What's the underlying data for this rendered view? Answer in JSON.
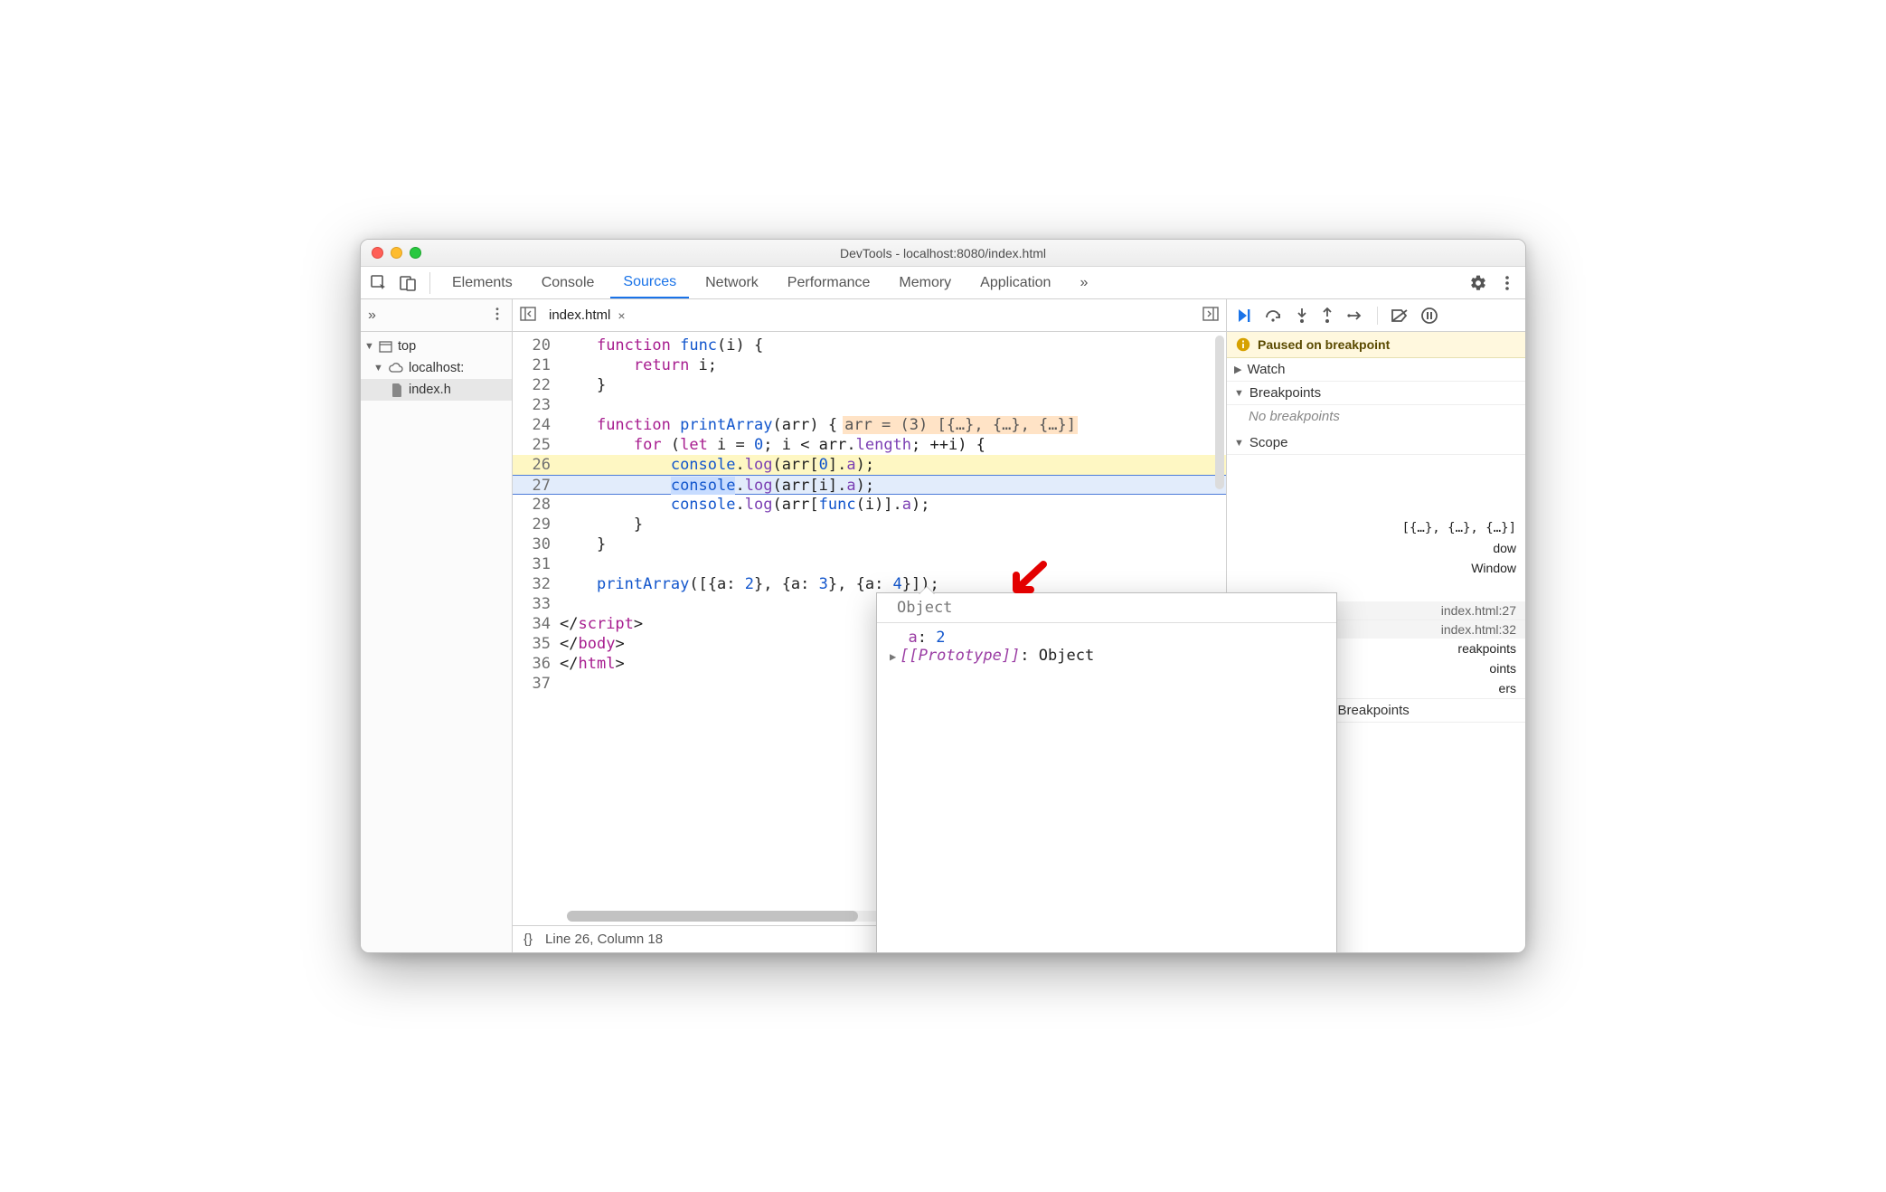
{
  "window": {
    "title": "DevTools - localhost:8080/index.html"
  },
  "tabs": {
    "items": [
      "Elements",
      "Console",
      "Sources",
      "Network",
      "Performance",
      "Memory",
      "Application"
    ],
    "activeIndex": 2,
    "overflow": "»"
  },
  "left": {
    "overflow": "»",
    "tree": {
      "root": "top",
      "host": "localhost:",
      "file": "index.h"
    }
  },
  "editor": {
    "tabName": "index.html",
    "closeGlyph": "×",
    "firstLine": 20,
    "highlightYellow": 26,
    "highlightBlue": 27,
    "lines": [
      {
        "raw": "    function func(i) {"
      },
      {
        "raw": "        return i;"
      },
      {
        "raw": "    }"
      },
      {
        "raw": ""
      },
      {
        "raw": "    function printArray(arr) {",
        "hint": "arr = (3) [{…}, {…}, {…}]"
      },
      {
        "raw": "        for (let i = 0; i < arr.length; ++i) {"
      },
      {
        "raw": "            console.log(arr[0].a);"
      },
      {
        "raw": "            console.log(arr[i].a);"
      },
      {
        "raw": "            console.log(arr[func(i)].a);"
      },
      {
        "raw": "        }"
      },
      {
        "raw": "    }"
      },
      {
        "raw": ""
      },
      {
        "raw": "    printArray([{a: 2}, {a: 3}, {a: 4}]);"
      },
      {
        "raw": ""
      },
      {
        "raw": "</script​>"
      },
      {
        "raw": "</body>"
      },
      {
        "raw": "</html>"
      },
      {
        "raw": ""
      }
    ],
    "status": {
      "braces": "{}",
      "pos": "Line 26, Column 18"
    }
  },
  "debug": {
    "pausedText": "Paused on breakpoint",
    "sections": {
      "watch": "Watch",
      "breakpoints": "Breakpoints",
      "breakpointsEmpty": "No breakpoints",
      "scope": "Scope",
      "callstackTail1": "[{…}, {…}, {…}]",
      "callstackTail2": "dow",
      "callstackTail3": "Window",
      "loc1": "index.html:27",
      "loc2": "index.html:32",
      "frag1": "reakpoints",
      "frag2": "oints",
      "frag3": "ers",
      "eventListener": "Event Listener Breakpoints"
    }
  },
  "popup": {
    "title": "Object",
    "propKey": "a",
    "propVal": "2",
    "protoKey": "[[Prototype]]",
    "protoVal": "Object"
  }
}
